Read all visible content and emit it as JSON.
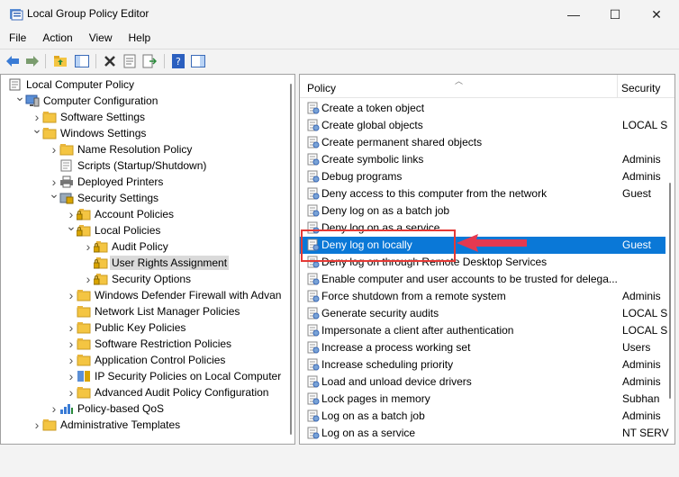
{
  "window": {
    "title": "Local Group Policy Editor",
    "minimize": "—",
    "maximize": "☐",
    "close": "✕"
  },
  "menu": [
    "File",
    "Action",
    "View",
    "Help"
  ],
  "tree": [
    {
      "label": "Local Computer Policy",
      "indent": 0,
      "chevron": "",
      "icon": "computer-policy"
    },
    {
      "label": "Computer Configuration",
      "indent": 1,
      "chevron": "v",
      "icon": "computer"
    },
    {
      "label": "Software Settings",
      "indent": 2,
      "chevron": ">",
      "icon": "folder"
    },
    {
      "label": "Windows Settings",
      "indent": 2,
      "chevron": "v",
      "icon": "folder"
    },
    {
      "label": "Name Resolution Policy",
      "indent": 3,
      "chevron": ">",
      "icon": "folder"
    },
    {
      "label": "Scripts (Startup/Shutdown)",
      "indent": 3,
      "chevron": "",
      "icon": "script"
    },
    {
      "label": "Deployed Printers",
      "indent": 3,
      "chevron": ">",
      "icon": "printer"
    },
    {
      "label": "Security Settings",
      "indent": 3,
      "chevron": "v",
      "icon": "security"
    },
    {
      "label": "Account Policies",
      "indent": 4,
      "chevron": ">",
      "icon": "folder-lock"
    },
    {
      "label": "Local Policies",
      "indent": 4,
      "chevron": "v",
      "icon": "folder-lock"
    },
    {
      "label": "Audit Policy",
      "indent": 5,
      "chevron": ">",
      "icon": "folder-lock"
    },
    {
      "label": "User Rights Assignment",
      "indent": 5,
      "chevron": "",
      "icon": "folder-lock",
      "selected": true
    },
    {
      "label": "Security Options",
      "indent": 5,
      "chevron": ">",
      "icon": "folder-lock"
    },
    {
      "label": "Windows Defender Firewall with Advan",
      "indent": 4,
      "chevron": ">",
      "icon": "folder"
    },
    {
      "label": "Network List Manager Policies",
      "indent": 4,
      "chevron": "",
      "icon": "folder"
    },
    {
      "label": "Public Key Policies",
      "indent": 4,
      "chevron": ">",
      "icon": "folder"
    },
    {
      "label": "Software Restriction Policies",
      "indent": 4,
      "chevron": ">",
      "icon": "folder"
    },
    {
      "label": "Application Control Policies",
      "indent": 4,
      "chevron": ">",
      "icon": "folder"
    },
    {
      "label": "IP Security Policies on Local Computer",
      "indent": 4,
      "chevron": ">",
      "icon": "ipsec"
    },
    {
      "label": "Advanced Audit Policy Configuration",
      "indent": 4,
      "chevron": ">",
      "icon": "folder"
    },
    {
      "label": "Policy-based QoS",
      "indent": 3,
      "chevron": ">",
      "icon": "qos"
    },
    {
      "label": "Administrative Templates",
      "indent": 2,
      "chevron": ">",
      "icon": "folder"
    }
  ],
  "list": {
    "header_policy": "Policy",
    "header_security": "Security",
    "rows": [
      {
        "name": "Create a token object",
        "security": ""
      },
      {
        "name": "Create global objects",
        "security": "LOCAL S"
      },
      {
        "name": "Create permanent shared objects",
        "security": ""
      },
      {
        "name": "Create symbolic links",
        "security": "Adminis"
      },
      {
        "name": "Debug programs",
        "security": "Adminis"
      },
      {
        "name": "Deny access to this computer from the network",
        "security": "Guest"
      },
      {
        "name": "Deny log on as a batch job",
        "security": ""
      },
      {
        "name": "Deny log on as a service",
        "security": ""
      },
      {
        "name": "Deny log on locally",
        "security": "Guest",
        "selected": true
      },
      {
        "name": "Deny log on through Remote Desktop Services",
        "security": ""
      },
      {
        "name": "Enable computer and user accounts to be trusted for delega...",
        "security": ""
      },
      {
        "name": "Force shutdown from a remote system",
        "security": "Adminis"
      },
      {
        "name": "Generate security audits",
        "security": "LOCAL S"
      },
      {
        "name": "Impersonate a client after authentication",
        "security": "LOCAL S"
      },
      {
        "name": "Increase a process working set",
        "security": "Users"
      },
      {
        "name": "Increase scheduling priority",
        "security": "Adminis"
      },
      {
        "name": "Load and unload device drivers",
        "security": "Adminis"
      },
      {
        "name": "Lock pages in memory",
        "security": "Subhan"
      },
      {
        "name": "Log on as a batch job",
        "security": "Adminis"
      },
      {
        "name": "Log on as a service",
        "security": "NT SERV"
      }
    ]
  },
  "colors": {
    "selection": "#0a78d7",
    "highlight": "#e53935",
    "folder": "#f4c542"
  }
}
